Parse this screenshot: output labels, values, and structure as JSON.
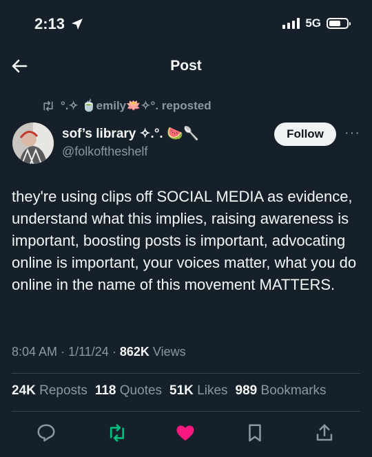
{
  "status_bar": {
    "time": "2:13",
    "network": "5G"
  },
  "header": {
    "title": "Post"
  },
  "repost": {
    "text": "°.✧ 🍵emily🪷✧°. reposted"
  },
  "author": {
    "name": "sof’s library ✧.°. 🍉🥄",
    "handle": "@folkoftheshelf"
  },
  "follow_label": "Follow",
  "more_label": "···",
  "tweet": {
    "text": "they're using clips off SOCIAL MEDIA as evidence, understand what this implies, raising awareness is important, boosting posts is important, advocating online is important, your voices matter, what you do online in the name of this movement MATTERS."
  },
  "meta": {
    "time": "8:04 AM",
    "dot": "·",
    "date": "1/11/24",
    "views_count": "862K",
    "views_label": "Views"
  },
  "stats": {
    "reposts_count": "24K",
    "reposts_label": "Reposts",
    "quotes_count": "118",
    "quotes_label": "Quotes",
    "likes_count": "51K",
    "likes_label": "Likes",
    "bookmarks_count": "989",
    "bookmarks_label": "Bookmarks"
  },
  "colors": {
    "background": "#15202b",
    "repost_green": "#00ba7c",
    "like_pink": "#f91880",
    "muted": "#8b98a5"
  },
  "icons": [
    "location-arrow-icon",
    "signal-icon",
    "battery-icon",
    "back-arrow-icon",
    "repost-icon",
    "reply-icon",
    "retweet-icon",
    "like-icon",
    "bookmark-icon",
    "share-icon"
  ]
}
